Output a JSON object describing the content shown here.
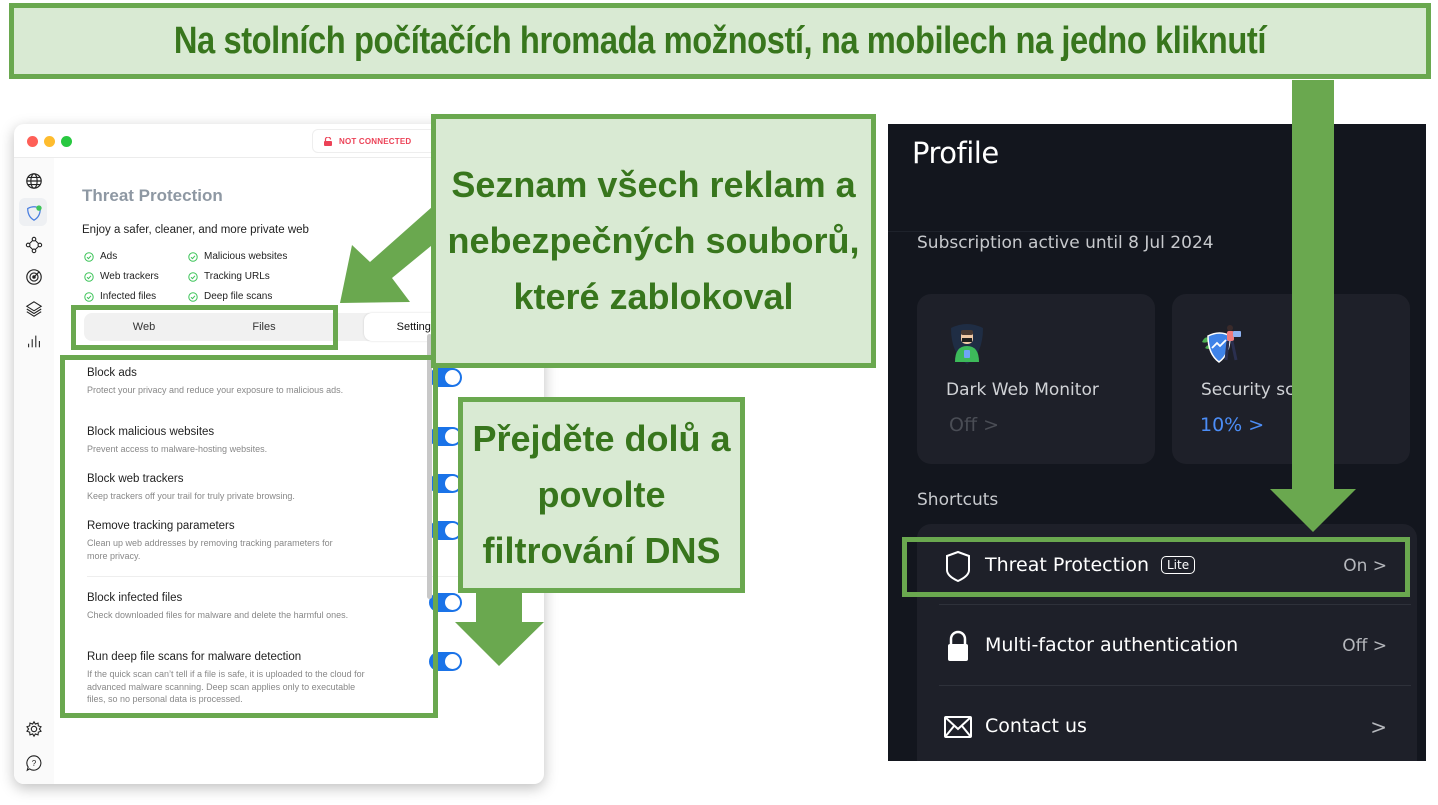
{
  "banner": {
    "text": "Na stolních počítačích hromada možností, na mobilech na jedno kliknutí"
  },
  "callouts": {
    "list": "Seznam všech reklam a nebezpečných souborů, které zablokoval",
    "dns": "Přejděte dolů a povolte filtrování DNS"
  },
  "desktop_app": {
    "status": {
      "text": "NOT CONNECTED",
      "icon": "lock-open-icon",
      "color": "#ec4257"
    },
    "sidebar": {
      "items": [
        {
          "name": "globe-icon"
        },
        {
          "name": "shield-icon",
          "active": true,
          "badge_color": "#3ec45a"
        },
        {
          "name": "mesh-network-icon"
        },
        {
          "name": "target-icon"
        },
        {
          "name": "layers-icon"
        },
        {
          "name": "stats-bars-icon"
        }
      ],
      "bottom": [
        {
          "name": "gear-icon"
        },
        {
          "name": "help-bubble-icon"
        }
      ]
    },
    "title": "Threat Protection",
    "subtitle": "Enjoy a safer, cleaner, and more private web",
    "features": [
      "Ads",
      "Malicious websites",
      "Web trackers",
      "Tracking URLs",
      "Infected files",
      "Deep file scans"
    ],
    "tabs": [
      {
        "label": "Web",
        "active": false
      },
      {
        "label": "Files",
        "active": false
      },
      {
        "label": "Settings",
        "active": true
      }
    ],
    "settings": [
      {
        "title": "Block ads",
        "desc": "Protect your privacy and reduce your exposure to malicious ads.",
        "enabled": true
      },
      {
        "title": "Block malicious websites",
        "desc": "Prevent access to malware-hosting websites.",
        "enabled": true
      },
      {
        "title": "Block web trackers",
        "desc": "Keep trackers off your trail for truly private browsing.",
        "enabled": true
      },
      {
        "title": "Remove tracking parameters",
        "desc": "Clean up web addresses by removing tracking parameters for more privacy.",
        "enabled": true
      },
      {
        "title": "Block infected files",
        "desc": "Check downloaded files for malware and delete the harmful ones.",
        "enabled": true
      },
      {
        "title": "Run deep file scans for malware detection",
        "desc": "If the quick scan can’t tell if a file is safe, it is uploaded to the cloud for advanced malware scanning. Deep scan applies only to executable files, so no personal data is processed.",
        "enabled": true
      }
    ],
    "toggle_color": "#1a73e8"
  },
  "mobile_app": {
    "title": "Profile",
    "subscription": "Subscription active until 8 Jul 2024",
    "cards": [
      {
        "title": "Dark Web Monitor",
        "value": "Off",
        "chevron": ">"
      },
      {
        "title": "Security sc",
        "value": "10%",
        "chevron": ">",
        "accent": "#4c8df6"
      }
    ],
    "shortcuts_label": "Shortcuts",
    "shortcuts": [
      {
        "label": "Threat Protection",
        "badge": "Lite",
        "value": "On",
        "chevron": ">",
        "icon": "shield-outline-icon"
      },
      {
        "label": "Multi-factor authentication",
        "value": "Off",
        "chevron": ">",
        "icon": "lock-icon"
      },
      {
        "label": "Contact us",
        "value": "",
        "chevron": ">",
        "icon": "envelope-icon"
      }
    ]
  },
  "colors": {
    "callout_fill": "#d9ead3",
    "callout_border": "#6aa84f",
    "callout_text": "#38761d"
  }
}
